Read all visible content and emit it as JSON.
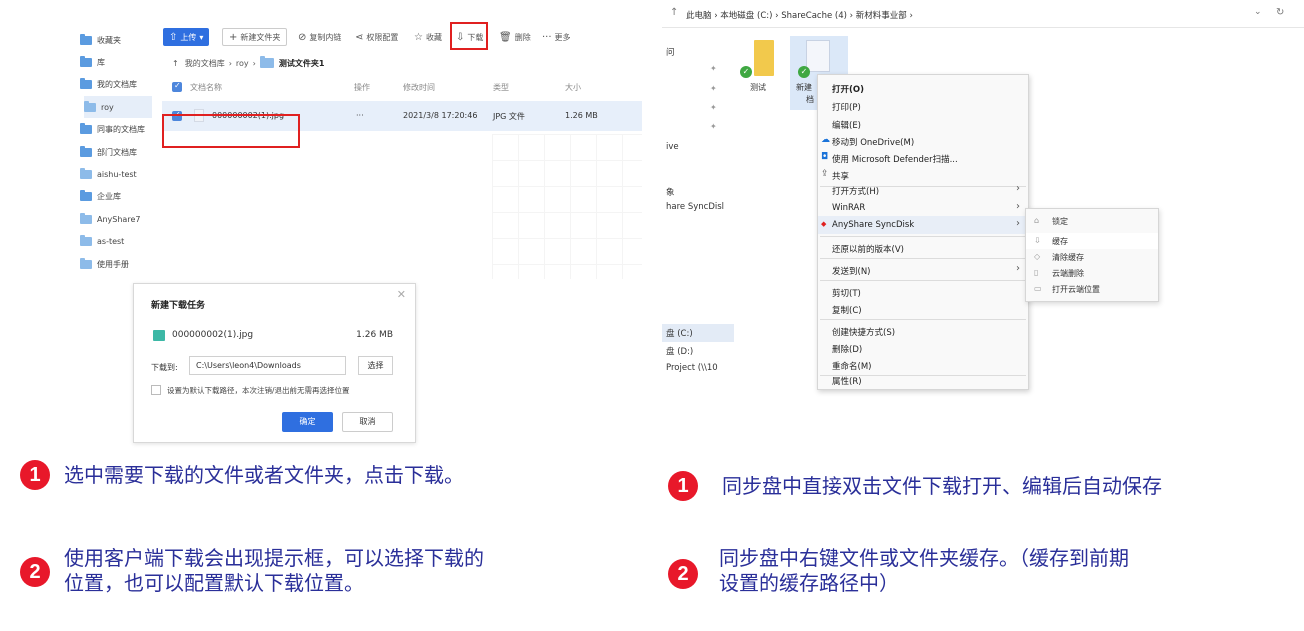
{
  "left_panel": {
    "sidebar": [
      {
        "label": "收藏夹"
      },
      {
        "label": "库"
      },
      {
        "label": "我的文档库"
      },
      {
        "label": "roy"
      },
      {
        "label": "同事的文档库"
      },
      {
        "label": "部门文档库"
      },
      {
        "label": "aishu-test"
      },
      {
        "label": "企业库"
      },
      {
        "label": "AnyShare7"
      },
      {
        "label": "as-test"
      },
      {
        "label": "使用手册"
      }
    ],
    "toolbar": {
      "upload": "上传",
      "new_folder": "新建文件夹",
      "copy_link": "复制内链",
      "permission": "权限配置",
      "favorite": "收藏",
      "download": "下载",
      "delete": "删除",
      "more": "更多"
    },
    "breadcrumb": {
      "root": "我的文档库",
      "user": "roy",
      "current": "测试文件夹1"
    },
    "table": {
      "headers": {
        "name": "文档名称",
        "action": "操作",
        "modified": "修改时间",
        "type": "类型",
        "size": "大小"
      },
      "row": {
        "name": "000000002(1).jpg",
        "action": "···",
        "modified": "2021/3/8 17:20:46",
        "type": "JPG 文件",
        "size": "1.26 MB"
      }
    },
    "dialog": {
      "title": "新建下载任务",
      "file_name": "000000002(1).jpg",
      "file_size": "1.26 MB",
      "download_to_label": "下载到:",
      "download_path": "C:\\Users\\leon4\\Downloads",
      "choose_button": "选择",
      "default_path_checkbox": "设置为默认下载路径，本次注销/退出前无需再选择位置",
      "confirm_button": "确定",
      "cancel_button": "取消"
    }
  },
  "right_panel": {
    "address": {
      "path": "此电脑 › 本地磁盘 (C:) › ShareCache (4) › 新材料事业部 ›"
    },
    "nav": [
      {
        "label": "问"
      },
      {
        "label": "ive"
      },
      {
        "label": "象"
      },
      {
        "label": "hare SyncDisl"
      },
      {
        "label": "盘 (C:)"
      },
      {
        "label": "盘 (D:)"
      },
      {
        "label": "Project (\\\\10"
      }
    ],
    "tiles": [
      {
        "label": "测试"
      },
      {
        "label": "新建"
      },
      {
        "label": "档"
      }
    ],
    "context_menu": [
      {
        "label": "打开(O)"
      },
      {
        "label": "打印(P)"
      },
      {
        "label": "编辑(E)"
      },
      {
        "label": "移动到 OneDrive(M)"
      },
      {
        "label": "使用 Microsoft Defender扫描..."
      },
      {
        "label": "共享"
      },
      {
        "label": "打开方式(H)"
      },
      {
        "label": "WinRAR"
      },
      {
        "label": "AnyShare SyncDisk"
      },
      {
        "label": "还原以前的版本(V)"
      },
      {
        "label": "发送到(N)"
      },
      {
        "label": "剪切(T)"
      },
      {
        "label": "复制(C)"
      },
      {
        "label": "创建快捷方式(S)"
      },
      {
        "label": "删除(D)"
      },
      {
        "label": "重命名(M)"
      },
      {
        "label": "属性(R)"
      }
    ],
    "submenu": [
      {
        "label": "锁定"
      },
      {
        "label": "缓存"
      },
      {
        "label": "清除缓存"
      },
      {
        "label": "云端删除"
      },
      {
        "label": "打开云端位置"
      }
    ]
  },
  "captions": {
    "left_1_badge": "1",
    "left_1": "选中需要下载的文件或者文件夹，点击下载。",
    "left_2_badge": "2",
    "left_2_line1": "使用客户端下载会出现提示框，可以选择下载的",
    "left_2_line2": "位置，也可以配置默认下载位置。",
    "right_1_badge": "1",
    "right_1": "同步盘中直接双击文件下载打开、编辑后自动保存",
    "right_2_badge": "2",
    "right_2_line1": "同步盘中右键文件或文件夹缓存。（缓存到前期",
    "right_2_line2": "设置的缓存路径中）"
  },
  "colors": {
    "accent_blue": "#2f6fe0",
    "highlight_red": "#e02020",
    "caption_text": "#2a2f99",
    "badge_red": "#e8182a"
  }
}
